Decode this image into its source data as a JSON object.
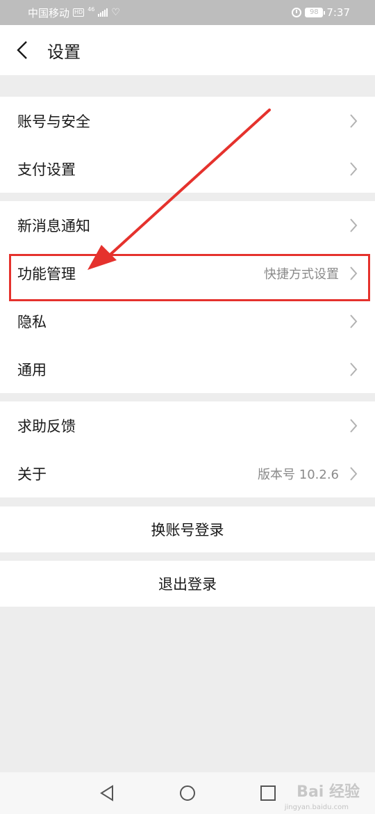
{
  "status_bar": {
    "carrier": "中国移动",
    "hd_badge": "HD",
    "network": "46",
    "battery": "98",
    "time": "7:37"
  },
  "header": {
    "title": "设置"
  },
  "groups": {
    "account": [
      {
        "label": "账号与安全"
      },
      {
        "label": "支付设置"
      }
    ],
    "functions": [
      {
        "label": "新消息通知"
      },
      {
        "label": "功能管理",
        "value": "快捷方式设置"
      },
      {
        "label": "隐私"
      },
      {
        "label": "通用"
      }
    ],
    "help": [
      {
        "label": "求助反馈"
      },
      {
        "label": "关于",
        "value": "版本号 10.2.6"
      }
    ]
  },
  "actions": {
    "switch_account": "换账号登录",
    "logout": "退出登录"
  },
  "annotation": {
    "color": "#e5322d"
  },
  "watermark": {
    "text": "Bai 经验",
    "url": "jingyan.baidu.com"
  },
  "colors": {
    "background": "#ededed",
    "surface": "#ffffff",
    "status_bar": "#bdbdbd",
    "secondary_text": "#8a8a8a"
  }
}
